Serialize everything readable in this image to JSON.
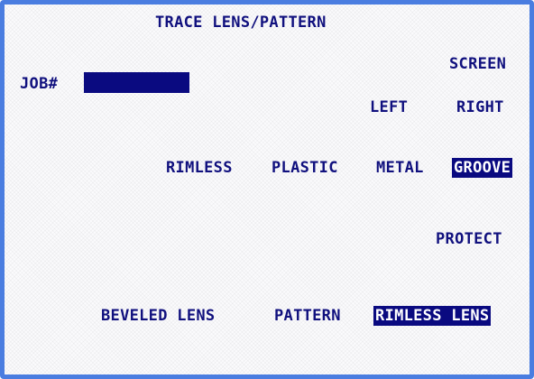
{
  "screen": {
    "title": "TRACE LENS/PATTERN",
    "job_label": "JOB#",
    "job_value": ""
  },
  "screen_section": {
    "label": "SCREEN",
    "left": "LEFT",
    "right": "RIGHT"
  },
  "frame_type": {
    "options": [
      "RIMLESS",
      "PLASTIC",
      "METAL",
      "GROOVE"
    ],
    "selected": "GROOVE"
  },
  "protect": {
    "label": "PROTECT"
  },
  "trace_mode": {
    "options": [
      "BEVELED LENS",
      "PATTERN",
      "RIMLESS LENS"
    ],
    "selected": "RIMLESS LENS"
  },
  "colors": {
    "border": "#4a7de0",
    "text": "#10107e",
    "highlight": "#0a0a80",
    "highlight_text": "#ffffff"
  }
}
